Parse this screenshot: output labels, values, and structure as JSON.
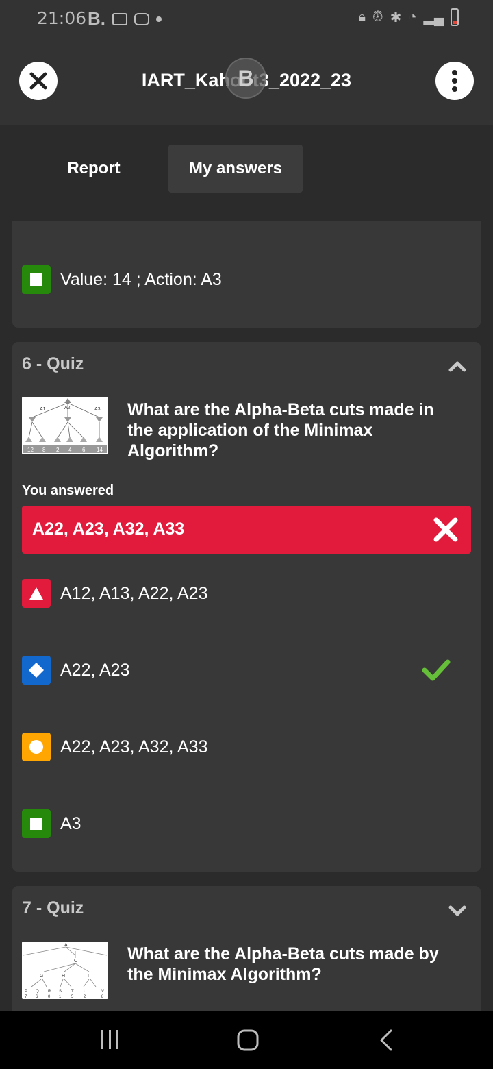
{
  "status_bar": {
    "time": "21:06",
    "b_label": "B."
  },
  "app_bar": {
    "title": "IART_Kahoot3_2022_23",
    "avatar_letter": "B"
  },
  "tabs": [
    {
      "label": "Report"
    },
    {
      "label": "My answers"
    }
  ],
  "previous_card": {
    "option": {
      "shape": "square",
      "color": "#26890c",
      "text": "Value: 14 ; Action: A3"
    }
  },
  "question6": {
    "header": "6 - Quiz",
    "question": "What are the Alpha-Beta cuts made in the application of the Minimax Algorithm?",
    "thumb_leaves": [
      "12",
      "8",
      "2",
      "4",
      "6",
      "14"
    ],
    "thumb_nodes": [
      "A1",
      "A2",
      "A3"
    ],
    "you_answered_label": "You answered",
    "your_answer": "A22, A23, A32, A33",
    "options": [
      {
        "shape": "triangle",
        "color": "#e21b3c",
        "text": "A12, A13, A22, A23",
        "correct": false
      },
      {
        "shape": "diamond",
        "color": "#1368ce",
        "text": "A22, A23",
        "correct": true
      },
      {
        "shape": "circle",
        "color": "#ffa602",
        "text": "A22, A23, A32, A33",
        "correct": false
      },
      {
        "shape": "square",
        "color": "#26890c",
        "text": "A3",
        "correct": false
      }
    ]
  },
  "question7": {
    "header": "7 - Quiz",
    "question": "What are the Alpha-Beta cuts made by the Minimax Algorithm?",
    "thumb_nodes": [
      "A",
      "C",
      "G",
      "H",
      "I"
    ],
    "thumb_leaves": [
      "P",
      "Q",
      "R",
      "S",
      "T",
      "U",
      "V"
    ],
    "thumb_values": [
      "7",
      "6",
      "0",
      "1",
      "5",
      "2",
      "8"
    ]
  },
  "colors": {
    "background": "#2b2b2b",
    "card": "#383838",
    "incorrect": "#e21b3c",
    "correct_check": "#66bf39"
  }
}
